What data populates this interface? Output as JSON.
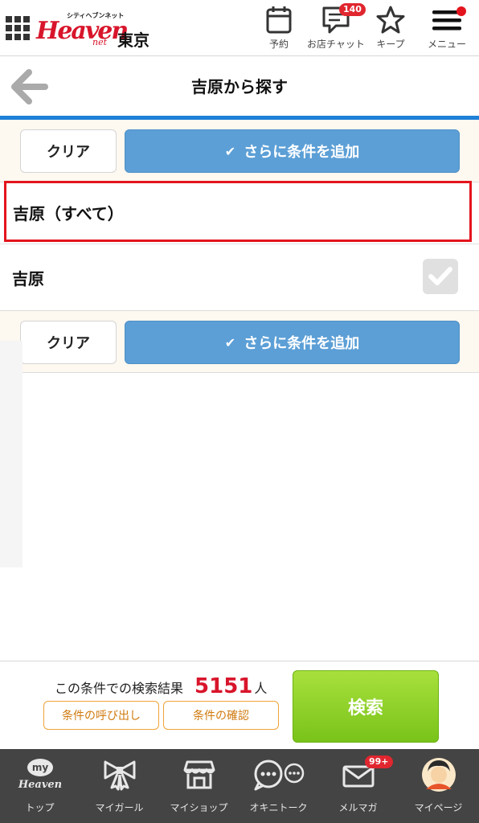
{
  "header": {
    "logo": {
      "small_text": "シティヘブンネット",
      "main_text": "Heaven",
      "net_text": "net"
    },
    "region": "東京",
    "items": [
      {
        "label": "予約",
        "icon": "calendar-icon"
      },
      {
        "label": "お店チャット",
        "icon": "chat-icon",
        "badge": "140"
      },
      {
        "label": "キープ",
        "icon": "star-icon"
      },
      {
        "label": "メニュー",
        "icon": "hamburger-menu-icon"
      }
    ]
  },
  "titlebar": {
    "title": "吉原から探す",
    "back_icon": "back-arrow-icon"
  },
  "actions": {
    "clear_label": "クリア",
    "add_label": "さらに条件を追加"
  },
  "list": {
    "all_item": "吉原（すべて）",
    "items": [
      {
        "label": "吉原",
        "checked": true
      }
    ]
  },
  "result": {
    "prefix": "この条件での検索結果",
    "count": "5151",
    "unit": "人",
    "recall_label": "条件の呼び出し",
    "confirm_label": "条件の確認",
    "search_label": "検索"
  },
  "bottom_nav": [
    {
      "label": "トップ",
      "icon": "my-heaven-icon",
      "icon_text_top": "my",
      "icon_text_bottom": "Heaven"
    },
    {
      "label": "マイガール",
      "icon": "ribbon-icon"
    },
    {
      "label": "マイショップ",
      "icon": "shop-icon"
    },
    {
      "label": "オキニトーク",
      "icon": "speech-bubbles-icon"
    },
    {
      "label": "メルマガ",
      "icon": "mail-icon",
      "badge": "99+"
    },
    {
      "label": "マイページ",
      "icon": "avatar-icon"
    }
  ],
  "colors": {
    "accent_red": "#d8152b",
    "blue": "#5c9fd6",
    "green": "#79c31a",
    "orange": "#f0a33b",
    "nav_bg": "#444444"
  }
}
